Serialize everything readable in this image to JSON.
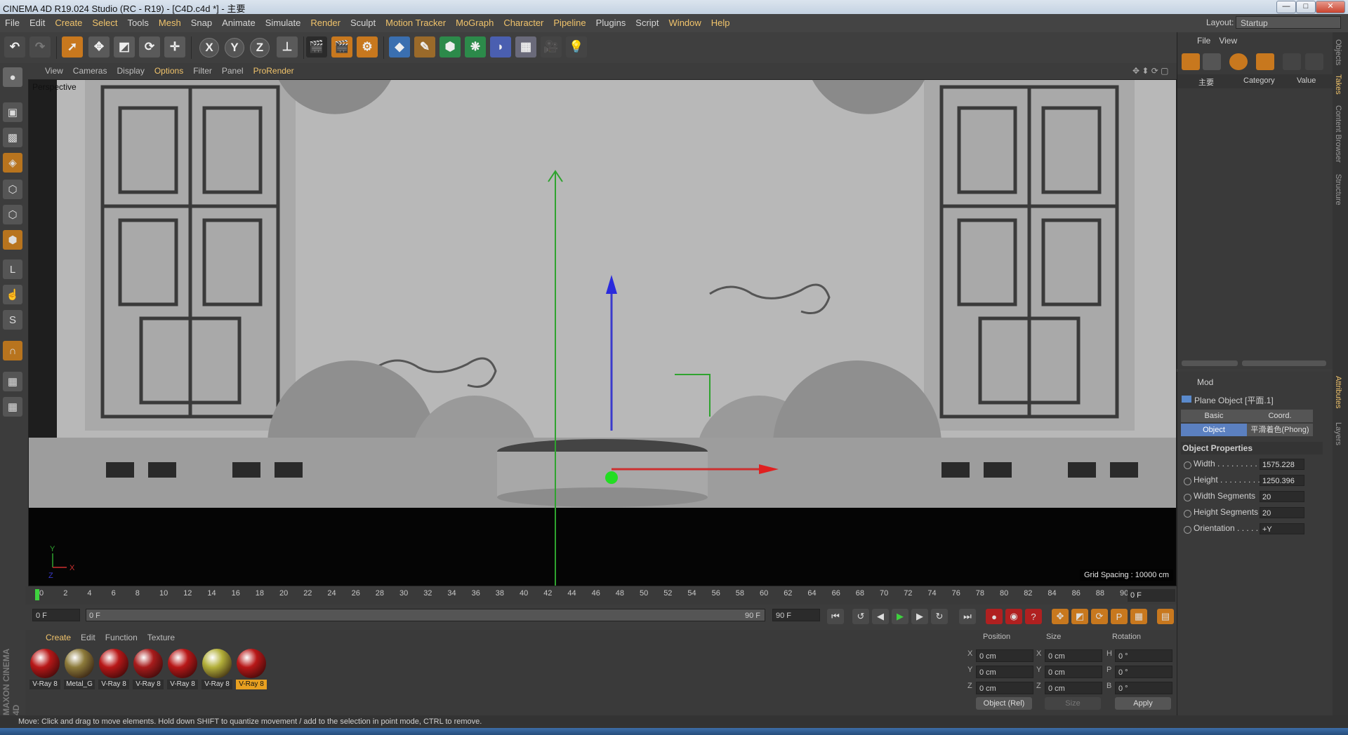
{
  "window": {
    "title": "CINEMA 4D R19.024 Studio (RC - R19) - [C4D.c4d *] - 主要",
    "minimize": "—",
    "maximize": "□",
    "close": "✕"
  },
  "menu": [
    "File",
    "Edit",
    "Create",
    "Select",
    "Tools",
    "Mesh",
    "Snap",
    "Animate",
    "Simulate",
    "Render",
    "Sculpt",
    "Motion Tracker",
    "MoGraph",
    "Character",
    "Pipeline",
    "Plugins",
    "Script",
    "Window",
    "Help"
  ],
  "layout": {
    "label": "Layout:",
    "value": "Startup"
  },
  "viewport": {
    "menu": [
      "View",
      "Cameras",
      "Display",
      "Options",
      "Filter",
      "Panel",
      "ProRender"
    ],
    "name": "Perspective",
    "grid_spacing": "Grid Spacing : 10000 cm"
  },
  "timeline": {
    "ticks": [
      "0",
      "2",
      "4",
      "6",
      "8",
      "10",
      "12",
      "14",
      "16",
      "18",
      "20",
      "22",
      "24",
      "26",
      "28",
      "30",
      "32",
      "34",
      "36",
      "38",
      "40",
      "42",
      "44",
      "46",
      "48",
      "50",
      "52",
      "54",
      "56",
      "58",
      "60",
      "62",
      "64",
      "66",
      "68",
      "70",
      "72",
      "74",
      "76",
      "78",
      "80",
      "82",
      "84",
      "86",
      "88",
      "90"
    ],
    "current_frame": "0 F",
    "start": "0 F",
    "range_start": "0 F",
    "range_end": "90 F",
    "end": "90 F"
  },
  "materials": {
    "menu": [
      "Create",
      "Edit",
      "Function",
      "Texture"
    ],
    "items": [
      {
        "label": "V-Ray 8",
        "color": "#b81818"
      },
      {
        "label": "Metal_G",
        "color": "#8c7a3a"
      },
      {
        "label": "V-Ray 8",
        "color": "#b81818"
      },
      {
        "label": "V-Ray 8",
        "color": "#a81c1c"
      },
      {
        "label": "V-Ray 8",
        "color": "#b81818"
      },
      {
        "label": "V-Ray 8",
        "color": "#b3b03a"
      },
      {
        "label": "V-Ray 8",
        "color": "#b81818"
      }
    ]
  },
  "coords": {
    "headers": [
      "Position",
      "Size",
      "Rotation"
    ],
    "rows": [
      {
        "axis": "X",
        "pos": "0 cm",
        "saxis": "X",
        "size": "0 cm",
        "raxis": "H",
        "rot": "0 °"
      },
      {
        "axis": "Y",
        "pos": "0 cm",
        "saxis": "Y",
        "size": "0 cm",
        "raxis": "P",
        "rot": "0 °"
      },
      {
        "axis": "Z",
        "pos": "0 cm",
        "saxis": "Z",
        "size": "0 cm",
        "raxis": "B",
        "rot": "0 °"
      }
    ],
    "mode": "Object (Rel)",
    "size_mode": "Size",
    "apply": "Apply"
  },
  "status": "Move: Click and drag to move elements. Hold down SHIFT to quantize movement / add to the selection in point mode, CTRL to remove.",
  "objects": {
    "menu": [
      "File",
      "View"
    ],
    "col_name": "主要",
    "col_category": "Category",
    "col_value": "Value"
  },
  "attributes": {
    "mode_label": "Mod",
    "object_title": "Plane Object [平面.1]",
    "tabs": [
      "Basic",
      "Coord.",
      "Object",
      "平滑着色(Phong)"
    ],
    "section": "Object Properties",
    "props": [
      {
        "label": "Width . . . . . . . . . .",
        "value": "1575.228"
      },
      {
        "label": "Height . . . . . . . . . .",
        "value": "1250.396"
      },
      {
        "label": "Width Segments",
        "value": "20"
      },
      {
        "label": "Height Segments",
        "value": "20"
      },
      {
        "label": "Orientation . . . . .",
        "value": "+Y"
      }
    ]
  },
  "side_tabs": [
    "Objects",
    "Takes",
    "Content Browser",
    "Structure",
    "Attributes",
    "Layers"
  ],
  "brand": "MAXON CINEMA 4D"
}
